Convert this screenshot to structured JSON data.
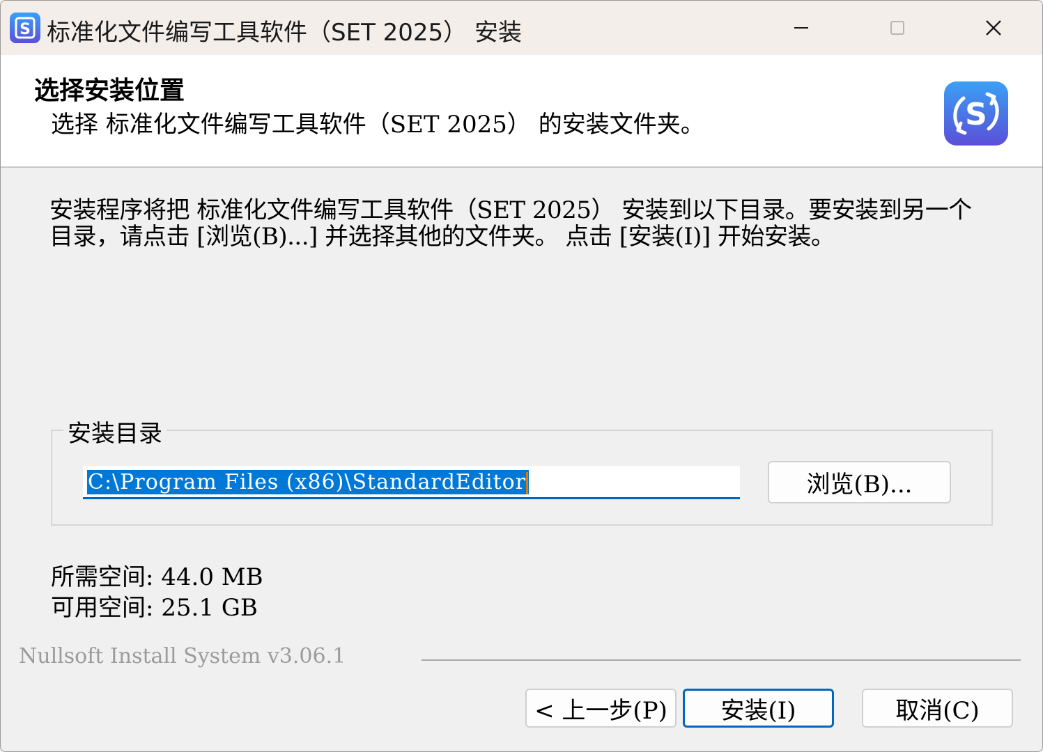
{
  "window": {
    "title": "标准化文件编写工具软件（SET 2025） 安装"
  },
  "header": {
    "title": "选择安装位置",
    "subtitle": "选择 标准化文件编写工具软件（SET 2025） 的安装文件夹。",
    "logo_icon": "set-logo-icon"
  },
  "description": "安装程序将把 标准化文件编写工具软件（SET 2025） 安装到以下目录。要安装到另一个目录，请点击 [浏览(B)...] 并选择其他的文件夹。 点击 [安装(I)] 开始安装。",
  "destination": {
    "group_label": "安装目录",
    "path_value": "C:\\Program Files (x86)\\StandardEditor",
    "browse_label": "浏览(B)..."
  },
  "space": {
    "required": "所需空间: 44.0 MB",
    "available": "可用空间: 25.1 GB"
  },
  "branding": "Nullsoft Install System v3.06.1",
  "buttons": {
    "back": "< 上一步(P)",
    "install": "安装(I)",
    "cancel": "取消(C)"
  },
  "colors": {
    "accent": "#0067c0",
    "selection": "#0078d7",
    "logo_gradient_top": "#3aa0f5",
    "logo_gradient_bottom": "#5b4fd8"
  }
}
